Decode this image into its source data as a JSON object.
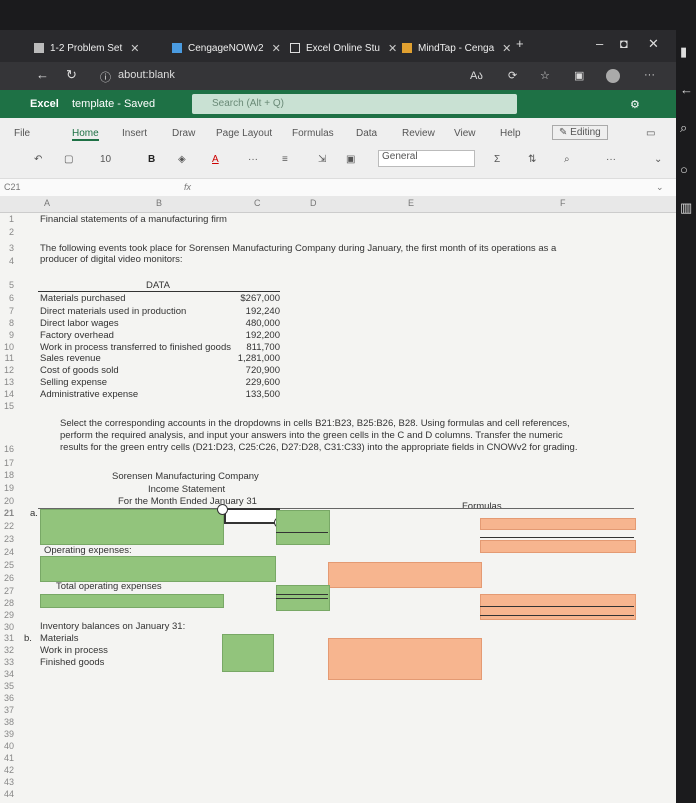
{
  "browser": {
    "tabs": [
      {
        "label": "1-2 Problem Set"
      },
      {
        "label": "CengageNOWv2"
      },
      {
        "label": "Excel Online Stu"
      },
      {
        "label": "MindTap - Cenga"
      }
    ],
    "address": "about:blank"
  },
  "excel": {
    "app": "Excel",
    "file": "template - Saved",
    "search_placeholder": "Search (Alt + Q)",
    "ribbon_tabs": [
      "File",
      "Home",
      "Insert",
      "Draw",
      "Page Layout",
      "Formulas",
      "Data",
      "Review",
      "View",
      "Help"
    ],
    "editing": "Editing",
    "font_size": "10",
    "number_format": "General",
    "name_box": "C21",
    "fx": "fx"
  },
  "columns": [
    "A",
    "B",
    "C",
    "D",
    "E",
    "F"
  ],
  "rows": [
    "1",
    "2",
    "3",
    "4",
    "5",
    "6",
    "7",
    "8",
    "9",
    "10",
    "11",
    "12",
    "13",
    "14",
    "15",
    "16",
    "17",
    "18",
    "19",
    "20",
    "21",
    "22",
    "23",
    "24",
    "25",
    "26",
    "27",
    "28",
    "29",
    "30",
    "31",
    "32",
    "33",
    "34",
    "35",
    "36",
    "37",
    "38",
    "39",
    "40",
    "41",
    "42",
    "43",
    "44"
  ],
  "content": {
    "title": "Financial statements of a manufacturing firm",
    "intro_1": "The following events took place for Sorensen Manufacturing Company during January, the first month of its operations as a",
    "intro_2": "producer of digital video monitors:",
    "data_heading": "DATA",
    "data_rows": [
      {
        "label": "Materials purchased",
        "value": "$267,000"
      },
      {
        "label": "Direct materials used in production",
        "value": "192,240"
      },
      {
        "label": "Direct labor wages",
        "value": "480,000"
      },
      {
        "label": "Factory overhead",
        "value": "192,200"
      },
      {
        "label": "Work in process transferred to finished goods",
        "value": "811,700"
      },
      {
        "label": "Sales revenue",
        "value": "1,281,000"
      },
      {
        "label": "Cost of goods sold",
        "value": "720,900"
      },
      {
        "label": "Selling expense",
        "value": "229,600"
      },
      {
        "label": "Administrative expense",
        "value": "133,500"
      }
    ],
    "instructions_1": "Select the corresponding accounts in the dropdowns in cells B21:B23, B25:B26, B28. Using formulas and cell references,",
    "instructions_2": "perform the required analysis, and input your answers into the green cells in the C and D columns. Transfer the numeric",
    "instructions_3": "results for the green entry cells (D21:D23, C25:C26, D27:D28, C31:C33) into the appropriate fields in CNOWv2 for grading.",
    "company": "Sorensen Manufacturing Company",
    "statement": "Income Statement",
    "period": "For the Month Ended January 31",
    "formulas_label": "Formulas",
    "row21_a": "a.",
    "operating_expenses": "Operating expenses:",
    "total_operating": "Total operating expenses",
    "inventory_heading": "Inventory balances on January 31:",
    "row31_b": "b.",
    "materials": "Materials",
    "wip": "Work in process",
    "finished": "Finished goods"
  }
}
